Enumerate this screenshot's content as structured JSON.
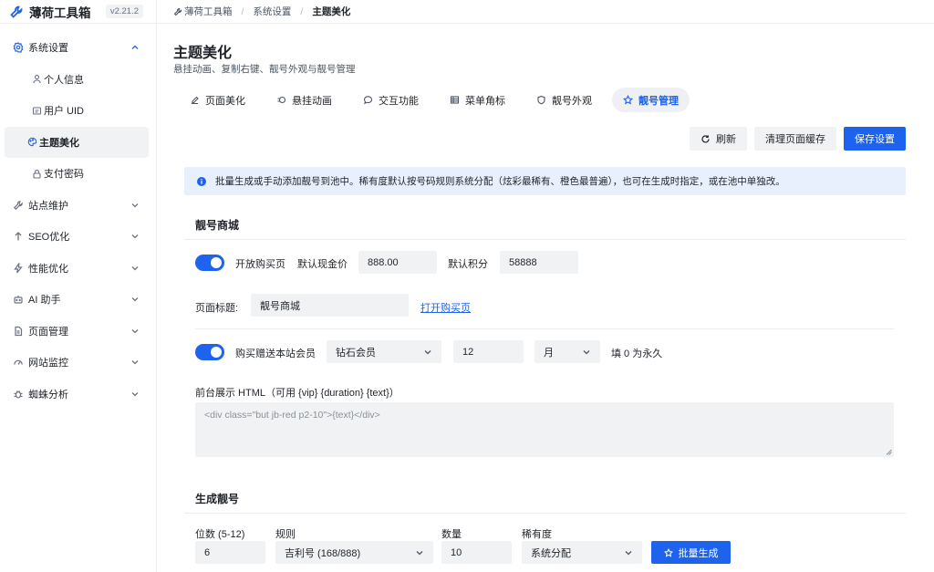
{
  "sidebar": {
    "brand": "薄荷工具箱",
    "version": "v2.21.2",
    "items": [
      {
        "label": "系统设置",
        "icon": "gear-icon",
        "expanded": true
      },
      {
        "label": "站点维护",
        "icon": "wrench-icon"
      },
      {
        "label": "SEO优化",
        "icon": "arrow-up-icon"
      },
      {
        "label": "性能优化",
        "icon": "bolt-icon"
      },
      {
        "label": "AI 助手",
        "icon": "robot-icon"
      },
      {
        "label": "页面管理",
        "icon": "page-icon"
      },
      {
        "label": "网站监控",
        "icon": "gauge-icon"
      },
      {
        "label": "蜘蛛分析",
        "icon": "bug-icon"
      }
    ],
    "subitems": [
      {
        "label": "个人信息",
        "icon": "user-icon"
      },
      {
        "label": "用户 UID",
        "icon": "id-card-icon"
      },
      {
        "label": "主题美化",
        "icon": "palette-icon",
        "active": true
      },
      {
        "label": "支付密码",
        "icon": "lock-icon"
      }
    ]
  },
  "breadcrumb": [
    "薄荷工具箱",
    "系统设置",
    "主题美化"
  ],
  "page": {
    "title": "主题美化",
    "subtitle": "悬挂动画、复制右键、靓号外观与靓号管理"
  },
  "tabs": [
    {
      "label": "页面美化",
      "icon": "brush-icon"
    },
    {
      "label": "悬挂动画",
      "icon": "animation-icon"
    },
    {
      "label": "交互功能",
      "icon": "chat-icon"
    },
    {
      "label": "菜单角标",
      "icon": "table-icon"
    },
    {
      "label": "靓号外观",
      "icon": "shield-icon"
    },
    {
      "label": "靓号管理",
      "icon": "star-icon",
      "active": true
    }
  ],
  "actions": {
    "refresh": "刷新",
    "clear_cache": "清理页面缓存",
    "save": "保存设置"
  },
  "notice": "批量生成或手动添加靓号到池中。稀有度默认按号码规则系统分配（炫彩最稀有、橙色最普遍），也可在生成时指定，或在池中单独改。",
  "shop": {
    "title": "靓号商城",
    "open_label": "开放购买页",
    "open_enabled": true,
    "price_label": "默认现金价",
    "price_value": "888.00",
    "points_label": "默认积分",
    "points_value": "58888",
    "page_title_label": "页面标题:",
    "page_title_value": "靓号商城",
    "open_link": "打开购买页",
    "gift_label": "购买赠送本站会员",
    "gift_enabled": true,
    "vip_value": "钻石会员",
    "duration_value": "12",
    "unit_value": "月",
    "forever_hint": "填 0 为永久",
    "html_label": "前台展示 HTML（可用 {vip} {duration} {text}）",
    "html_placeholder": "<div class=\"but jb-red p2-10\">{text}</div>"
  },
  "generate": {
    "title": "生成靓号",
    "digits_label": "位数 (5-12)",
    "digits_value": "6",
    "rule_label": "规则",
    "rule_value": "吉利号 (168/888)",
    "count_label": "数量",
    "count_value": "10",
    "rarity_label": "稀有度",
    "rarity_value": "系统分配",
    "button": "批量生成"
  },
  "colors": {
    "accent": "#1d63ed",
    "notice_bg": "#e8f0fd",
    "input_bg": "#f1f2f4"
  }
}
